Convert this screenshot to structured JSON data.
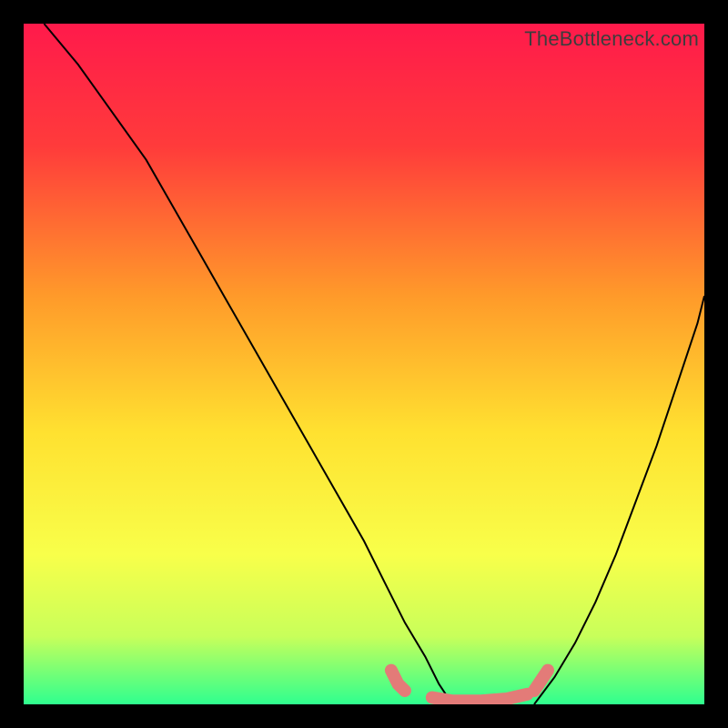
{
  "watermark": "TheBottleneck.com",
  "chart_data": {
    "type": "line",
    "title": "",
    "xlabel": "",
    "ylabel": "",
    "xlim": [
      0,
      100
    ],
    "ylim": [
      0,
      100
    ],
    "gradient_stops": [
      {
        "offset": 0,
        "color": "#ff1a4b"
      },
      {
        "offset": 18,
        "color": "#ff3b3b"
      },
      {
        "offset": 40,
        "color": "#ff9a2a"
      },
      {
        "offset": 60,
        "color": "#ffe130"
      },
      {
        "offset": 78,
        "color": "#f8ff4a"
      },
      {
        "offset": 90,
        "color": "#c8ff5a"
      },
      {
        "offset": 96,
        "color": "#6bff7a"
      },
      {
        "offset": 100,
        "color": "#2fff8f"
      }
    ],
    "series": [
      {
        "name": "bottleneck-curve-left",
        "color": "#000000",
        "x": [
          3,
          8,
          13,
          18,
          22,
          26,
          30,
          34,
          38,
          42,
          46,
          50,
          53,
          56,
          59,
          61,
          63
        ],
        "y": [
          100,
          94,
          87,
          80,
          73,
          66,
          59,
          52,
          45,
          38,
          31,
          24,
          18,
          12,
          7,
          3,
          0
        ]
      },
      {
        "name": "bottleneck-curve-right",
        "color": "#000000",
        "x": [
          75,
          78,
          81,
          84,
          87,
          90,
          93,
          96,
          99,
          100
        ],
        "y": [
          0,
          4,
          9,
          15,
          22,
          30,
          38,
          47,
          56,
          60
        ]
      }
    ],
    "bottom_highlight": {
      "color": "#e37b78",
      "segments": [
        {
          "x": [
            54,
            55,
            56
          ],
          "y": [
            5,
            3,
            2
          ]
        },
        {
          "x": [
            60,
            63,
            67,
            71,
            74
          ],
          "y": [
            1,
            0.5,
            0.5,
            0.8,
            1.5
          ]
        },
        {
          "x": [
            75,
            76,
            77
          ],
          "y": [
            2,
            3.5,
            5
          ]
        }
      ]
    }
  }
}
